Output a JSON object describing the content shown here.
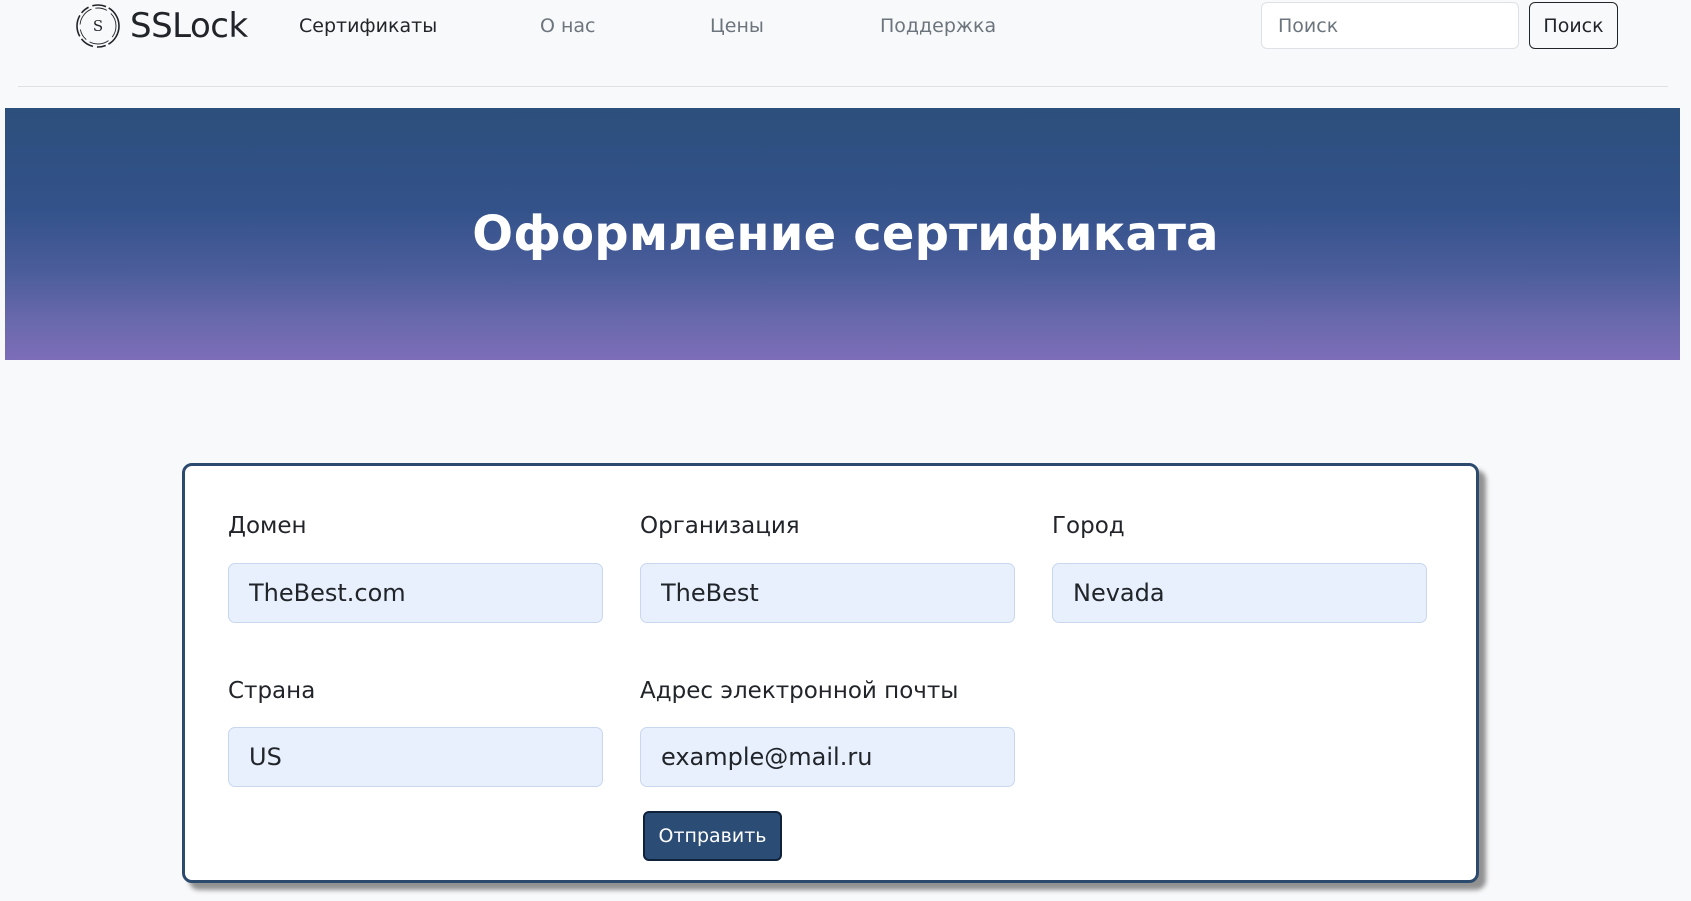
{
  "brand": {
    "name": "SSLock",
    "logo_letter": "S",
    "logo_icon": "circle-s-logo-icon"
  },
  "nav": {
    "items": [
      {
        "label": "Сертификаты",
        "active": true
      },
      {
        "label": "О нас",
        "active": false
      },
      {
        "label": "Цены",
        "active": false
      },
      {
        "label": "Поддержка",
        "active": false
      }
    ]
  },
  "search": {
    "placeholder": "Поиск",
    "value": "",
    "button_label": "Поиск"
  },
  "hero": {
    "title": "Оформление сертификата",
    "gradient_top": "#2c4f7c",
    "gradient_bottom": "#7d6db8"
  },
  "form": {
    "fields": [
      {
        "label": "Домен",
        "value": "TheBest.com"
      },
      {
        "label": "Организация",
        "value": "TheBest"
      },
      {
        "label": "Город",
        "value": "Nevada"
      },
      {
        "label": "Страна",
        "value": "US"
      },
      {
        "label": "Адрес электронной почты",
        "value": "example@mail.ru"
      }
    ],
    "submit_label": "Отправить",
    "submit_color": "#2b4c74",
    "field_background": "#e8f0fe"
  }
}
